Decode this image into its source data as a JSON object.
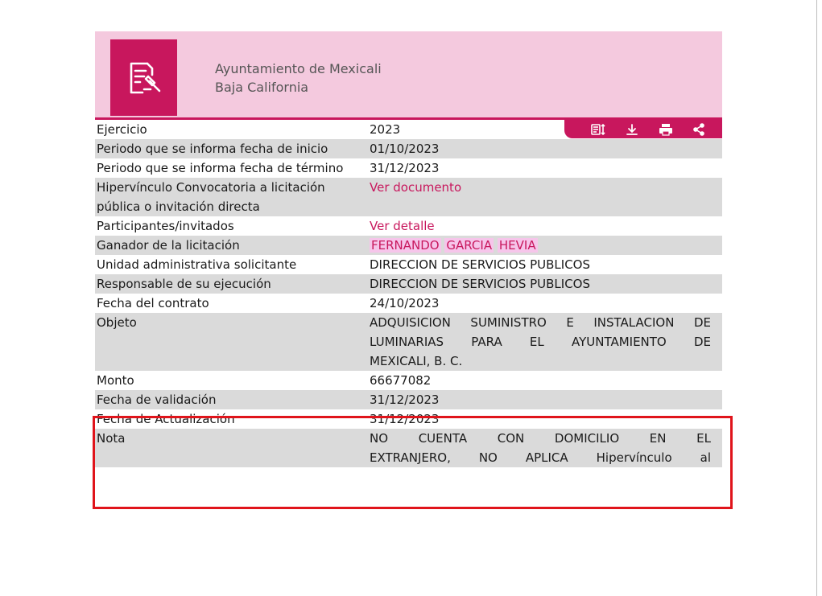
{
  "header": {
    "org_line1": "Ayuntamiento de Mexicali",
    "org_line2": "Baja California",
    "logo_icon": "contract-gavel-icon"
  },
  "toolbar": {
    "icons": [
      "filter-sort-icon",
      "download-icon",
      "print-icon",
      "share-icon"
    ]
  },
  "rows": {
    "ejercicio": {
      "label": "Ejercicio",
      "value": "2023"
    },
    "periodo_inicio": {
      "label": "Periodo que se informa fecha de inicio",
      "value": "01/10/2023"
    },
    "periodo_termino": {
      "label": "Periodo que se informa fecha de término",
      "value": "31/12/2023"
    },
    "hipervinculo": {
      "label": "Hipervínculo Convocatoria a licitación pública o invitación directa",
      "value": "Ver documento"
    },
    "participantes": {
      "label": "Participantes/invitados",
      "value": "Ver detalle"
    },
    "ganador": {
      "label": "Ganador de la licitación",
      "first": "FERNANDO",
      "second": "GARCIA",
      "third": "HEVIA"
    },
    "unidad": {
      "label": "Unidad administrativa solicitante",
      "value": "DIRECCION DE SERVICIOS PUBLICOS"
    },
    "responsable": {
      "label": "Responsable de su ejecución",
      "value": "DIRECCION DE SERVICIOS PUBLICOS"
    },
    "fecha_contrato": {
      "label": "Fecha del contrato",
      "value": "24/10/2023"
    },
    "objeto": {
      "label": "Objeto",
      "line1": "ADQUISICION SUMINISTRO E INSTALACION DE",
      "line2": "LUMINARIAS PARA EL AYUNTAMIENTO DE",
      "line3": "MEXICALI, B. C."
    },
    "monto": {
      "label": "Monto",
      "value": "66677082"
    },
    "fecha_validacion": {
      "label": "Fecha de validación",
      "value": "31/12/2023"
    },
    "fecha_actualizacion": {
      "label": "Fecha de Actualización",
      "value": "31/12/2023"
    },
    "nota": {
      "label": "Nota",
      "line1": "NO CUENTA CON DOMICILIO EN EL",
      "line2": "EXTRANJERO, NO APLICA Hipervínculo al"
    }
  },
  "colors": {
    "accent": "#c8175d",
    "header_bg": "#f4c9de",
    "row_gray": "#dadada",
    "highlight_box": "#e0141b"
  }
}
